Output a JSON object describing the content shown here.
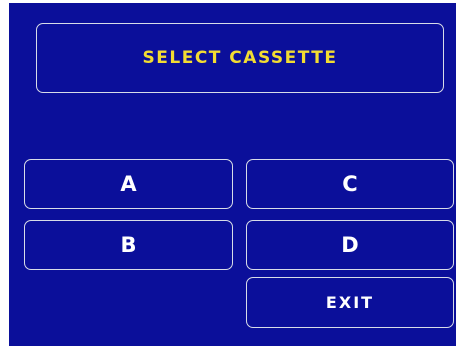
{
  "screen": {
    "title": "SELECT CASSETTE",
    "background_color": "#0b0f9a",
    "title_color": "#f2dc32",
    "button_text_color": "#ffffff",
    "border_color": "#d8dce8"
  },
  "buttons": {
    "a": "A",
    "b": "B",
    "c": "C",
    "d": "D",
    "exit": "EXIT"
  }
}
